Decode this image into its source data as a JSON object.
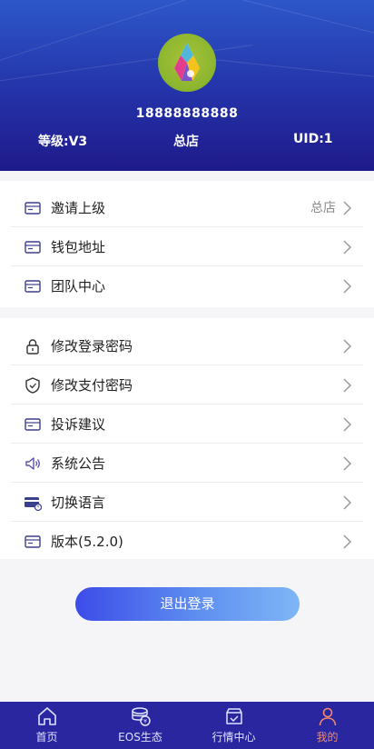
{
  "profile": {
    "phone": "18888888888",
    "level": "等级:V3",
    "store": "总店",
    "uid": "UID:1"
  },
  "menu_group_1": [
    {
      "label": "邀请上级",
      "extra": "总店",
      "icon": "card-icon"
    },
    {
      "label": "钱包地址",
      "extra": "",
      "icon": "card-icon"
    },
    {
      "label": "团队中心",
      "extra": "",
      "icon": "card-icon"
    }
  ],
  "menu_group_2": [
    {
      "label": "修改登录密码",
      "icon": "lock-icon"
    },
    {
      "label": "修改支付密码",
      "icon": "shield-icon"
    },
    {
      "label": "投诉建议",
      "icon": "card-icon"
    },
    {
      "label": "系统公告",
      "icon": "speaker-icon"
    },
    {
      "label": "切换语言",
      "icon": "credit-card-icon"
    },
    {
      "label": "版本(5.2.0)",
      "icon": "card-icon"
    }
  ],
  "logout_label": "退出登录",
  "tabbar": [
    {
      "label": "首页",
      "icon": "home-icon",
      "active": false
    },
    {
      "label": "EOS生态",
      "icon": "coins-icon",
      "active": false
    },
    {
      "label": "行情中心",
      "icon": "box-icon",
      "active": false
    },
    {
      "label": "我的",
      "icon": "user-icon",
      "active": true
    }
  ],
  "colors": {
    "header_top": "#2d57c9",
    "header_bottom": "#1f1a8a",
    "tabbar_bg": "#2a26a0",
    "active_tab": "#f08a6a",
    "logout_start": "#3d4ce9",
    "logout_end": "#7fb6f6",
    "icon_stroke": "#3b3f8c"
  }
}
